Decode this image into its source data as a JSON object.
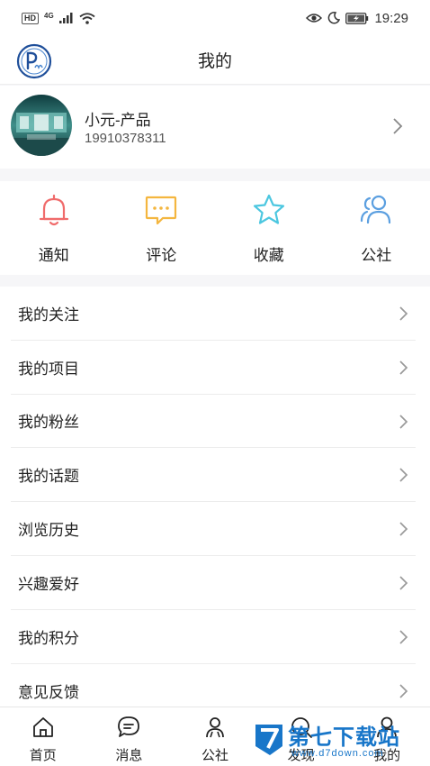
{
  "status_bar": {
    "time": "19:29",
    "network": "4G"
  },
  "header": {
    "title": "我的",
    "logo_icon": "app-logo-icon"
  },
  "profile": {
    "name": "小元-产品",
    "phone": "19910378311"
  },
  "quick_actions": [
    {
      "label": "通知",
      "icon": "bell-icon",
      "color": "#f06b6b"
    },
    {
      "label": "评论",
      "icon": "comment-icon",
      "color": "#f4b63f"
    },
    {
      "label": "收藏",
      "icon": "star-icon",
      "color": "#4cc7e0"
    },
    {
      "label": "公社",
      "icon": "people-icon",
      "color": "#5b9fe0"
    }
  ],
  "menu": [
    {
      "label": "我的关注"
    },
    {
      "label": "我的项目"
    },
    {
      "label": "我的粉丝"
    },
    {
      "label": "我的话题"
    },
    {
      "label": "浏览历史"
    },
    {
      "label": "兴趣爱好"
    },
    {
      "label": "我的积分"
    },
    {
      "label": "意见反馈"
    }
  ],
  "tabbar": [
    {
      "label": "首页",
      "icon": "home-icon"
    },
    {
      "label": "消息",
      "icon": "message-icon"
    },
    {
      "label": "公社",
      "icon": "community-icon"
    },
    {
      "label": "发现",
      "icon": "discover-icon"
    },
    {
      "label": "我的",
      "icon": "user-icon"
    }
  ],
  "watermark": {
    "title": "第七下载站",
    "url": "www.d7down.com"
  }
}
